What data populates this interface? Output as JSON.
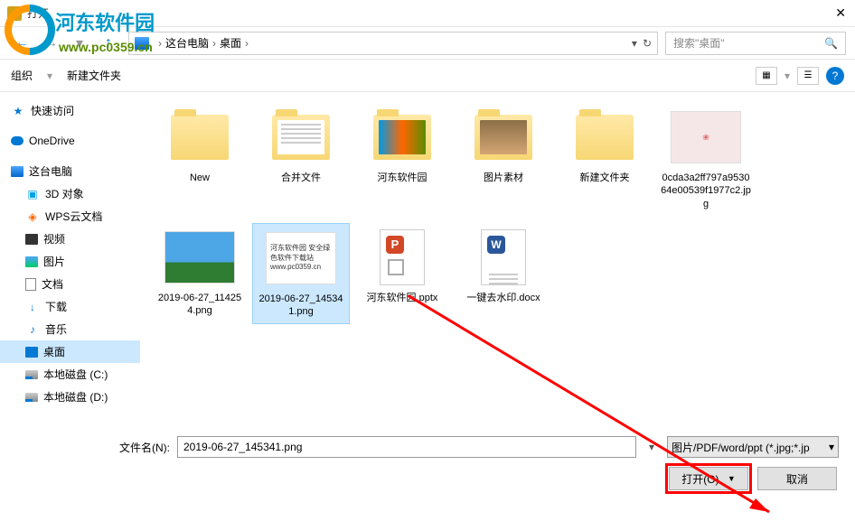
{
  "titlebar": {
    "title": "打开"
  },
  "watermark": {
    "text": "河东软件园",
    "url": "www.pc0359.cn"
  },
  "breadcrumb": {
    "pc": "这台电脑",
    "desktop": "桌面"
  },
  "search": {
    "placeholder": "搜索\"桌面\""
  },
  "toolbar": {
    "organize": "组织",
    "new_folder": "新建文件夹"
  },
  "sidebar": {
    "items": [
      {
        "label": "快速访问",
        "icon": "star"
      },
      {
        "label": "OneDrive",
        "icon": "cloud"
      },
      {
        "label": "这台电脑",
        "icon": "pc"
      },
      {
        "label": "3D 对象",
        "icon": "3d",
        "indent": true
      },
      {
        "label": "WPS云文档",
        "icon": "wps",
        "indent": true
      },
      {
        "label": "视频",
        "icon": "video",
        "indent": true
      },
      {
        "label": "图片",
        "icon": "pic",
        "indent": true
      },
      {
        "label": "文档",
        "icon": "doc",
        "indent": true
      },
      {
        "label": "下载",
        "icon": "down",
        "indent": true
      },
      {
        "label": "音乐",
        "icon": "music",
        "indent": true
      },
      {
        "label": "桌面",
        "icon": "desk",
        "indent": true,
        "selected": true
      },
      {
        "label": "本地磁盘 (C:)",
        "icon": "disk",
        "indent": true
      },
      {
        "label": "本地磁盘 (D:)",
        "icon": "disk",
        "indent": true
      }
    ]
  },
  "files": [
    {
      "name": "New",
      "type": "folder"
    },
    {
      "name": "合并文件",
      "type": "folder-text"
    },
    {
      "name": "河东软件园",
      "type": "folder-color"
    },
    {
      "name": "图片素材",
      "type": "folder-photo"
    },
    {
      "name": "新建文件夹",
      "type": "folder"
    },
    {
      "name": "0cda3a2ff797a953064e00539f1977c2.jpg",
      "type": "img-pink"
    },
    {
      "name": "2019-06-27_114254.png",
      "type": "img-landscape"
    },
    {
      "name": "2019-06-27_145341.png",
      "type": "img-doc",
      "selected": true
    },
    {
      "name": "河东软件园.pptx",
      "type": "pptx"
    },
    {
      "name": "一键去水印.docx",
      "type": "docx"
    }
  ],
  "footer": {
    "filename_label": "文件名(N):",
    "filename_value": "2019-06-27_145341.png",
    "filetype": "图片/PDF/word/ppt (*.jpg;*.jp",
    "open": "打开(O)",
    "cancel": "取消"
  }
}
